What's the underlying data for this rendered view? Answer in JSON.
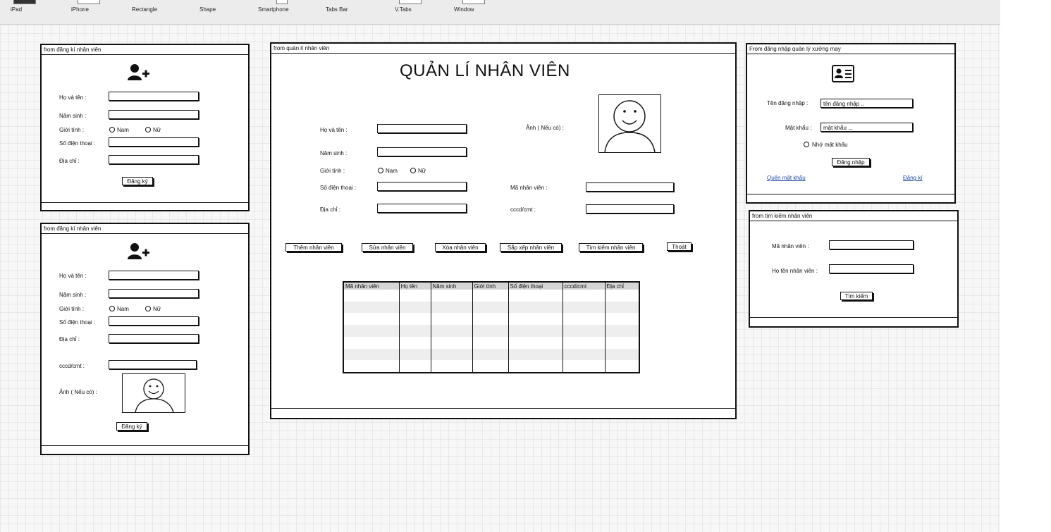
{
  "toolbar": {
    "items": [
      "iPad",
      "iPhone",
      "Rectangle",
      "Shape",
      "Smartphone",
      "Tabs Bar",
      "V.Tabs",
      "Window"
    ]
  },
  "reg1": {
    "title": "from đăng kí nhân viên",
    "icon": "user-plus-icon",
    "labels": {
      "name": "Họ và tên :",
      "year": "Năm sinh :",
      "gender": "Giới tính :",
      "phone": "Số điện thoại :",
      "address": "Địa chỉ :"
    },
    "male": "Nam",
    "female": "Nữ",
    "submit": "Đăng ký"
  },
  "reg2": {
    "title": "from đăng kí nhân viên",
    "icon": "user-plus-icon",
    "labels": {
      "name": "Họ và tên :",
      "year": "Năm sinh :",
      "gender": "Giới tính :",
      "phone": "Số điện thoại :",
      "address": "Địa chỉ :",
      "cccd": "cccd/cmt :",
      "photo": "Ảnh ( Nếu có) :"
    },
    "male": "Nam",
    "female": "Nữ",
    "submit": "Đăng ký"
  },
  "manage": {
    "title": "from quản lí nhân viên",
    "heading": "QUẢN LÍ NHÂN VIÊN",
    "labels": {
      "name": "Họ và tên :",
      "year": "Năm sinh :",
      "gender": "Giới tính :",
      "phone": "Số điện thoại :",
      "address": "Địa chỉ :",
      "photo": "Ảnh ( Nếu có) :",
      "code": "Mã nhân viên :",
      "cccd": "cccd/cmt :"
    },
    "male": "Nam",
    "female": "Nữ",
    "buttons": [
      "Thêm nhân viên",
      "Sửa nhân viên",
      "Xóa nhân viên",
      "Sắp xếp nhân viên",
      "Tìm kiếm nhân viên",
      "Thoát"
    ],
    "columns": [
      "Mã nhân viên",
      "Họ tên",
      "Năm sinh",
      "Giới tính",
      "Số điện thoại",
      "cccd/cmt",
      "Địa chỉ"
    ]
  },
  "login": {
    "title": "From đăng nhập quản lý xưởng may",
    "icon": "id-card-icon",
    "username_label": "Tên đăng nhập :",
    "username_value": "tên đăng nhập ..",
    "password_label": "Mật khẩu :",
    "password_value": "mật khẩu ...",
    "remember": "Nhớ mật khẩu",
    "submit": "Đăng nhập",
    "forgot": "Quên mật khẩu",
    "register": "Đăng kí"
  },
  "search": {
    "title": "from tìm kiếm nhân viên",
    "code_label": "Mã nhân viên :",
    "name_label": "Họ tên nhân viên :",
    "submit": "Tìm kiếm"
  }
}
